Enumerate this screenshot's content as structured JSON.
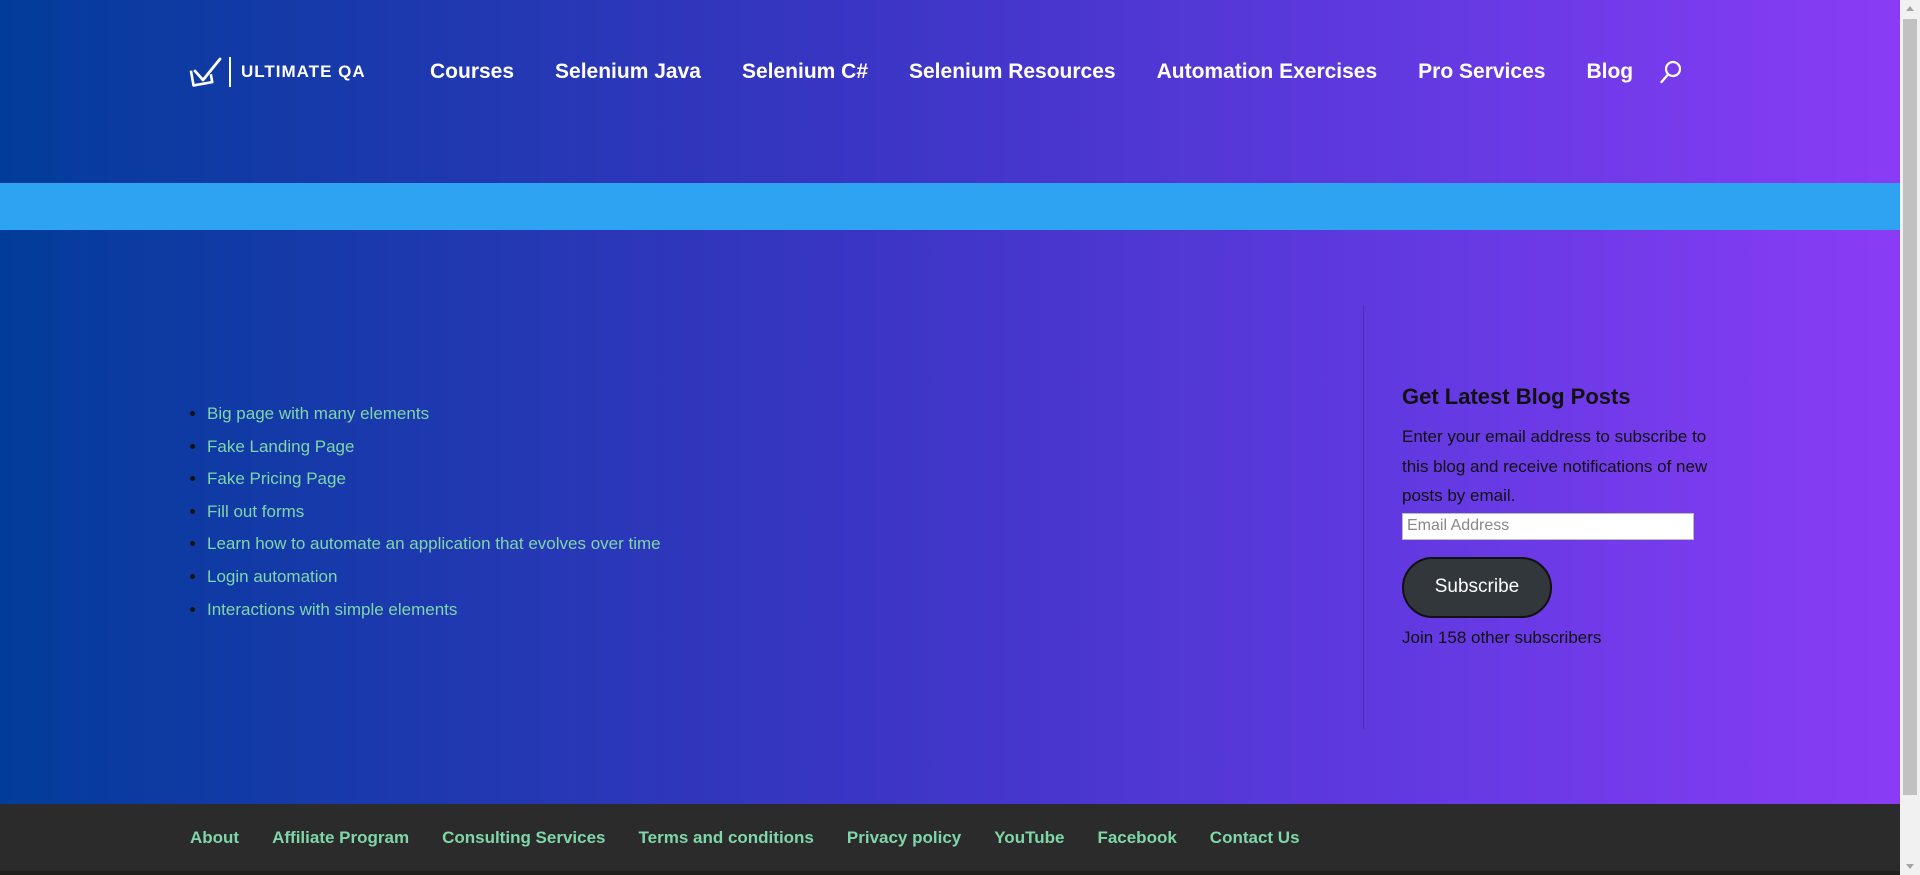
{
  "header": {
    "logo_text": "ULTIMATE QA",
    "nav": [
      {
        "label": "Courses"
      },
      {
        "label": "Selenium Java"
      },
      {
        "label": "Selenium C#"
      },
      {
        "label": "Selenium Resources"
      },
      {
        "label": "Automation Exercises"
      },
      {
        "label": "Pro Services"
      },
      {
        "label": "Blog"
      }
    ],
    "search_icon": "search-icon"
  },
  "colors": {
    "gradient_start": "#023c9a",
    "gradient_end": "#8a3cf5",
    "band": "#2ea3f2",
    "link": "#7fd6a8",
    "footer_bg": "#2b2b2b",
    "button_bg": "#32373c"
  },
  "main": {
    "links": [
      "Big page with many elements",
      "Fake Landing Page",
      "Fake Pricing Page",
      "Fill out forms",
      "Learn how to automate an application that evolves over time",
      "Login automation",
      "Interactions with simple elements"
    ]
  },
  "sidebar": {
    "title": "Get Latest Blog Posts",
    "description": "Enter your email address to subscribe to this blog and receive notifications of new posts by email.",
    "email_placeholder": "Email Address",
    "subscribe_label": "Subscribe",
    "subscriber_text": "Join 158 other subscribers"
  },
  "footer": {
    "links": [
      "About",
      "Affiliate Program",
      "Consulting Services",
      "Terms and conditions",
      "Privacy policy",
      "YouTube",
      "Facebook",
      "Contact Us"
    ]
  }
}
